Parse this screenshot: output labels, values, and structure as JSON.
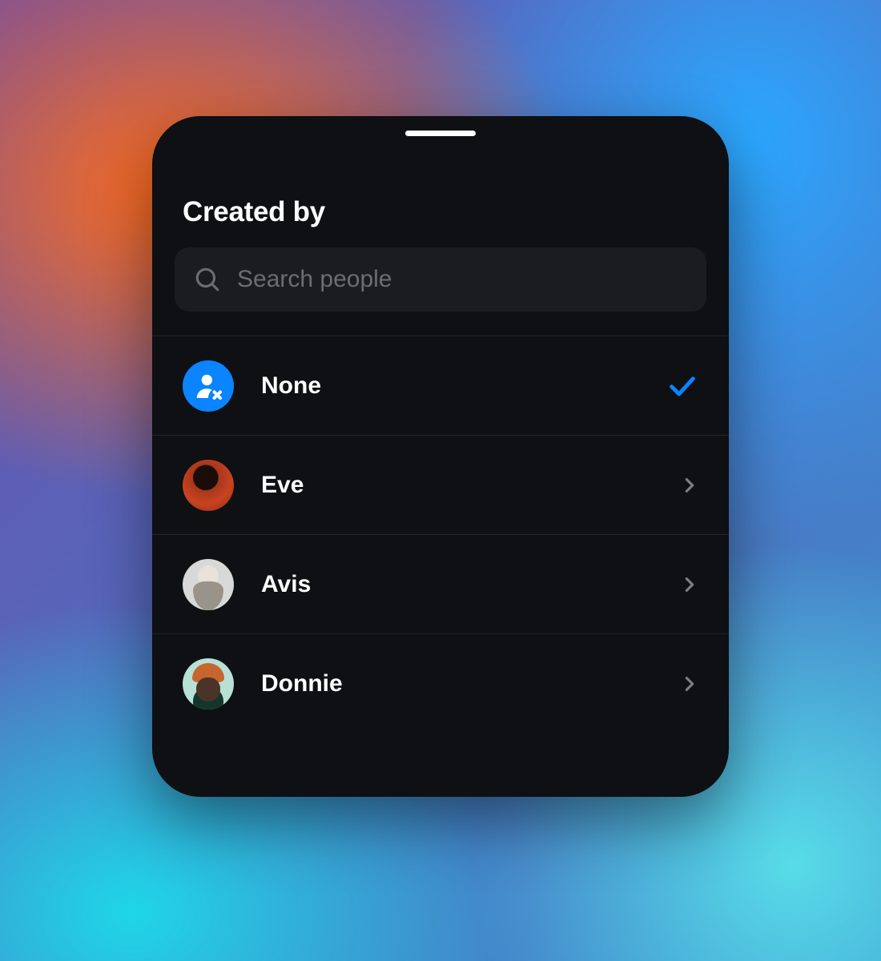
{
  "sheet": {
    "title": "Created by",
    "search_placeholder": "Search people"
  },
  "people": [
    {
      "id": "none",
      "name": "None",
      "selected": true,
      "icon": "person-x"
    },
    {
      "id": "eve",
      "name": "Eve",
      "selected": false,
      "icon": "avatar"
    },
    {
      "id": "avis",
      "name": "Avis",
      "selected": false,
      "icon": "avatar"
    },
    {
      "id": "donnie",
      "name": "Donnie",
      "selected": false,
      "icon": "avatar"
    }
  ],
  "colors": {
    "accent": "#0a84ff",
    "sheet_bg": "#0e1013"
  }
}
